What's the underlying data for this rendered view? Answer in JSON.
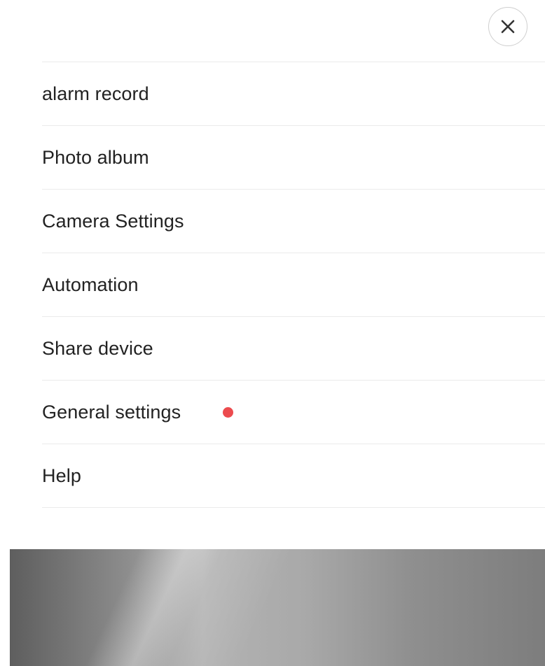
{
  "menu": {
    "items": [
      {
        "label": "alarm record"
      },
      {
        "label": "Photo album"
      },
      {
        "label": "Camera Settings"
      },
      {
        "label": "Automation"
      },
      {
        "label": "Share device"
      },
      {
        "label": "General settings",
        "badge": "red-dot"
      },
      {
        "label": "Help"
      }
    ]
  },
  "colors": {
    "badge": "#ec4b4e",
    "divider": "#ebebeb",
    "text": "#222222"
  },
  "icons": {
    "close": "close-icon"
  }
}
